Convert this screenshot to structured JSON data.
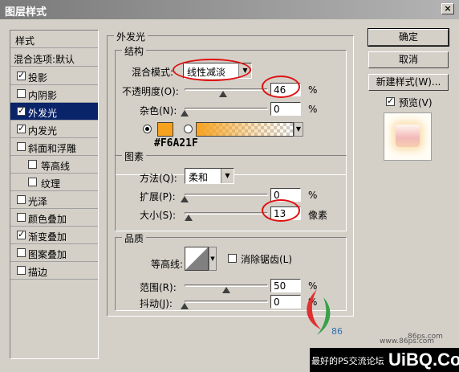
{
  "window": {
    "title": "图层样式",
    "close_glyph": "×"
  },
  "left_list": {
    "header": "样式",
    "blend_default": "混合选项:默认",
    "items": [
      {
        "label": "投影",
        "checked": true,
        "indent": false,
        "selected": false
      },
      {
        "label": "内阴影",
        "checked": false,
        "indent": false,
        "selected": false
      },
      {
        "label": "外发光",
        "checked": true,
        "indent": false,
        "selected": true
      },
      {
        "label": "内发光",
        "checked": true,
        "indent": false,
        "selected": false
      },
      {
        "label": "斜面和浮雕",
        "checked": false,
        "indent": false,
        "selected": false
      },
      {
        "label": "等高线",
        "checked": false,
        "indent": true,
        "selected": false
      },
      {
        "label": "纹理",
        "checked": false,
        "indent": true,
        "selected": false
      },
      {
        "label": "光泽",
        "checked": false,
        "indent": false,
        "selected": false
      },
      {
        "label": "颜色叠加",
        "checked": false,
        "indent": false,
        "selected": false
      },
      {
        "label": "渐变叠加",
        "checked": true,
        "indent": false,
        "selected": false
      },
      {
        "label": "图案叠加",
        "checked": false,
        "indent": false,
        "selected": false
      },
      {
        "label": "描边",
        "checked": false,
        "indent": false,
        "selected": false
      }
    ]
  },
  "outer_glow": {
    "title": "外发光",
    "structure": {
      "title": "结构",
      "blend_mode_label": "混合模式:",
      "blend_mode_value": "线性减淡",
      "opacity_label": "不透明度(O):",
      "opacity_value": "46",
      "opacity_fraction": 0.46,
      "noise_label": "杂色(N):",
      "noise_value": "0",
      "noise_fraction": 0,
      "unit_percent": "%",
      "color_hex": "#F6A21F",
      "color_label": "#F6A21F"
    },
    "elements": {
      "title": "图素",
      "method_label": "方法(Q):",
      "method_value": "柔和",
      "spread_label": "扩展(P):",
      "spread_value": "0",
      "spread_fraction": 0,
      "size_label": "大小(S):",
      "size_value": "13",
      "size_fraction": 0.05,
      "size_unit": "像素"
    },
    "quality": {
      "title": "品质",
      "contour_label": "等高线:",
      "antialias_label": "消除锯齿(L)",
      "range_label": "范围(R):",
      "range_value": "50",
      "range_fraction": 0.5,
      "jitter_label": "抖动(J):",
      "jitter_value": "0",
      "jitter_fraction": 0
    }
  },
  "buttons": {
    "ok": "确定",
    "cancel": "取消",
    "new_style": "新建样式(W)...",
    "preview_label": "预览(V)"
  },
  "watermark": {
    "site_small": "86ps.com",
    "site_url": "www.86ps.com",
    "brand": "UiBQ.CoM",
    "tagline": "最好的PS交流论坛"
  }
}
